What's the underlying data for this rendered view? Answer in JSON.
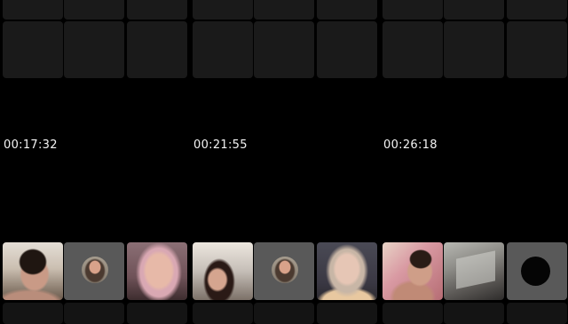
{
  "panels": [
    {
      "timestamp": "00:17:32",
      "participants": [
        {
          "type": "video",
          "desc": "participant-video"
        },
        {
          "type": "avatar"
        },
        {
          "type": "video",
          "desc": "participant-video"
        }
      ]
    },
    {
      "timestamp": "00:21:55",
      "participants": [
        {
          "type": "video",
          "desc": "participant-video"
        },
        {
          "type": "avatar"
        },
        {
          "type": "video",
          "desc": "participant-video"
        }
      ]
    },
    {
      "timestamp": "00:26:18",
      "participants": [
        {
          "type": "video",
          "desc": "participant-video"
        },
        {
          "type": "video",
          "desc": "participant-video"
        },
        {
          "type": "avatar-blank"
        }
      ]
    }
  ],
  "colors": {
    "background": "#000000",
    "tile_empty": "#1a1a1a",
    "tile_avatar": "#595959",
    "timestamp_text": "#f4f4f4"
  }
}
